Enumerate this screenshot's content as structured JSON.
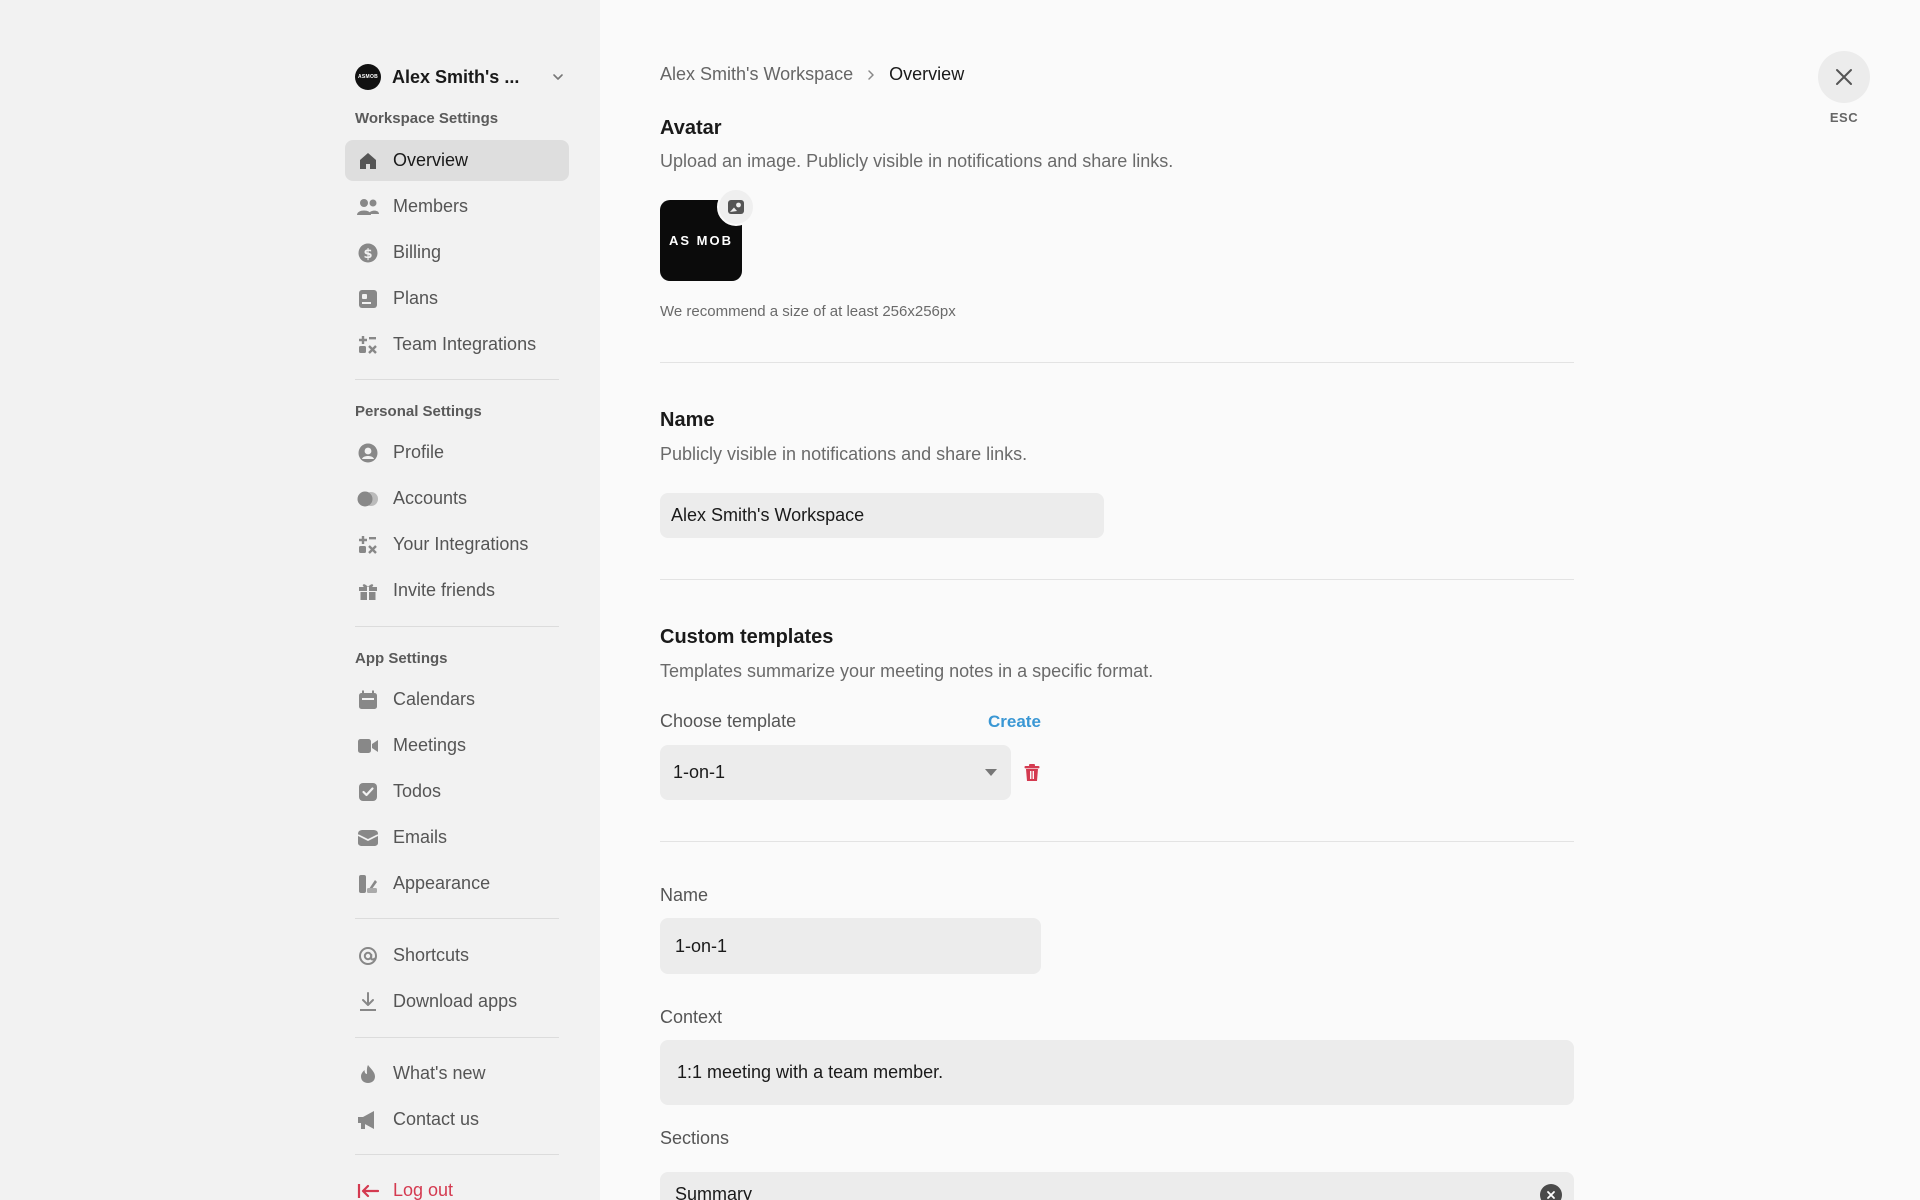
{
  "sidebar": {
    "workspace_name": "Alex Smith's ...",
    "workspace_logo_text": "ASMOB",
    "sections": {
      "workspace": "Workspace Settings",
      "personal": "Personal Settings",
      "app": "App Settings"
    },
    "items": {
      "overview": "Overview",
      "members": "Members",
      "billing": "Billing",
      "plans": "Plans",
      "team_integrations": "Team Integrations",
      "profile": "Profile",
      "accounts": "Accounts",
      "your_integrations": "Your Integrations",
      "invite_friends": "Invite friends",
      "calendars": "Calendars",
      "meetings": "Meetings",
      "todos": "Todos",
      "emails": "Emails",
      "appearance": "Appearance",
      "shortcuts": "Shortcuts",
      "download_apps": "Download apps",
      "whats_new": "What's new",
      "contact_us": "Contact us",
      "log_out": "Log out"
    }
  },
  "header": {
    "breadcrumb": [
      "Alex Smith's Workspace",
      "Overview"
    ],
    "esc_label": "ESC"
  },
  "avatar": {
    "title": "Avatar",
    "description": "Upload an image. Publicly visible in notifications and share links.",
    "logo_text": "AS MOB",
    "size_note": "We recommend a size of at least 256x256px"
  },
  "name_section": {
    "title": "Name",
    "description": "Publicly visible in notifications and share links.",
    "value": "Alex Smith's Workspace"
  },
  "templates": {
    "title": "Custom templates",
    "description": "Templates summarize your meeting notes in a specific format.",
    "choose_label": "Choose template",
    "create_label": "Create",
    "selected": "1-on-1",
    "name_label": "Name",
    "name_value": "1-on-1",
    "context_label": "Context",
    "context_value": "1:1 meeting with a team member.",
    "sections_label": "Sections",
    "sections_first": "Summary"
  },
  "colors": {
    "accent_link": "#3a97d4",
    "danger": "#d43a50",
    "sidebar_bg": "#f2f2f2",
    "active_item_bg": "#dedede"
  }
}
